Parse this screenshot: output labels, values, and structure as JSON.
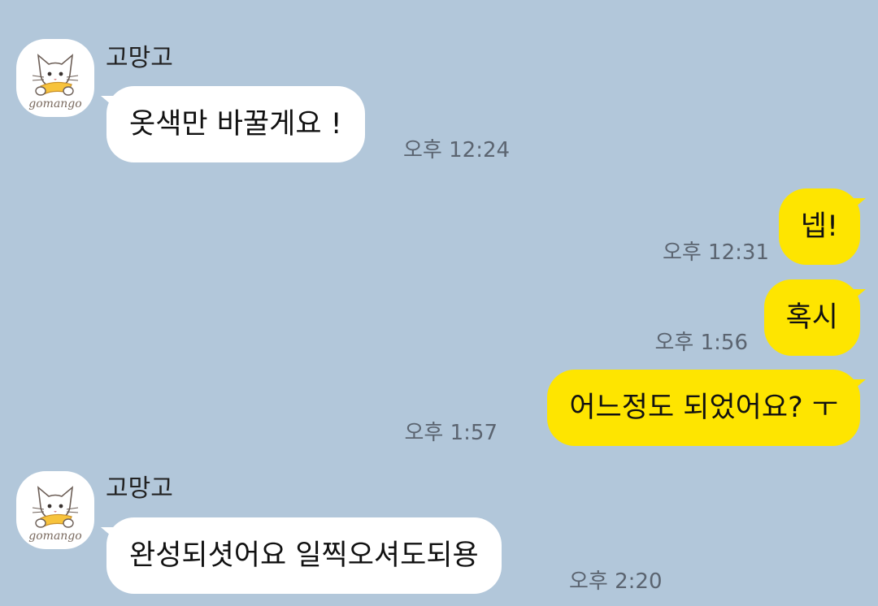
{
  "conversation": {
    "groups": [
      {
        "sender": "고망고",
        "avatar": {
          "icon": "cat-profile-icon",
          "logo_text": "gomango"
        },
        "message": "옷색만 바꿀게요 !",
        "time": "오후 12:24"
      },
      {
        "sender": "고망고",
        "avatar": {
          "icon": "cat-profile-icon",
          "logo_text": "gomango"
        },
        "message": "완성되셧어요 일찍오셔도되용",
        "time": "오후 2:20"
      }
    ],
    "outgoing": [
      {
        "message": "넵!",
        "time": "오후 12:31"
      },
      {
        "message": "혹시",
        "time": "오후 1:56"
      },
      {
        "message": "어느정도 되었어요? ㅜ",
        "time": "오후 1:57"
      }
    ]
  },
  "colors": {
    "background": "#b2c7da",
    "incoming_bubble": "#ffffff",
    "outgoing_bubble": "#fee500",
    "timestamp": "#5b6470"
  }
}
